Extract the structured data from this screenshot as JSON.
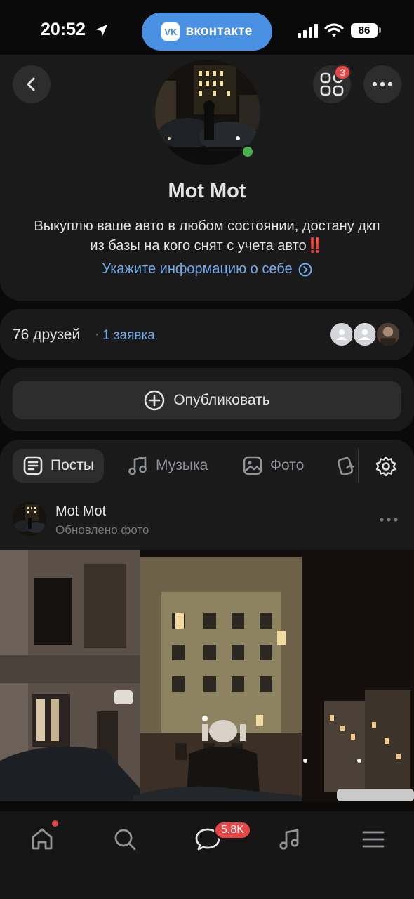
{
  "status_bar": {
    "time": "20:52",
    "app_pill": "вконтакте",
    "app_logo": "VK",
    "battery": "86"
  },
  "profile": {
    "name": "Mot Mot",
    "status": "Выкуплю ваше авто в любом состоянии, достану дкп из базы на кого снят с учета авто‼️",
    "about_link": "Укажите информацию о себе",
    "apps_badge": "3",
    "online_color": "#4bb34b"
  },
  "friends": {
    "count": "76 друзей",
    "separator": "·",
    "requests": "1 заявка"
  },
  "publish": {
    "label": "Опубликовать"
  },
  "tabs": [
    {
      "label": "Посты",
      "icon": "posts-icon",
      "active": true
    },
    {
      "label": "Музыка",
      "icon": "music-icon",
      "active": false
    },
    {
      "label": "Фото",
      "icon": "photo-icon",
      "active": false
    },
    {
      "label": "",
      "icon": "clips-icon",
      "active": false
    }
  ],
  "post": {
    "author": "Mot Mot",
    "subtitle": "Обновлено фото"
  },
  "bottom_nav": {
    "messages_badge": "5,8K",
    "items": [
      "home-icon",
      "search-icon",
      "messages-icon",
      "music-icon",
      "menu-icon"
    ]
  },
  "colors": {
    "accent": "#71aaeb",
    "pill": "#4a90e2",
    "badge": "#e64646",
    "card": "#1a1a1a"
  }
}
